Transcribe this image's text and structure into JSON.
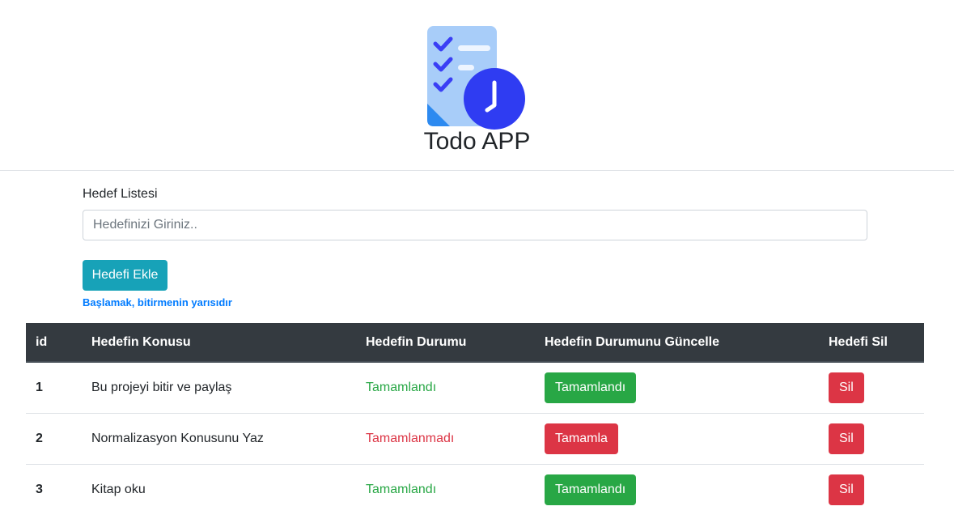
{
  "header": {
    "title": "Todo APP",
    "logo_icon": "checklist-clock-icon"
  },
  "form": {
    "label": "Hedef Listesi",
    "input_placeholder": "Hedefinizi Giriniz..",
    "input_value": "",
    "add_button": "Hedefi Ekle",
    "motto": "Başlamak, bitirmenin yarısıdır"
  },
  "table": {
    "columns": [
      "id",
      "Hedefin Konusu",
      "Hedefin Durumu",
      "Hedefin Durumunu Güncelle",
      "Hedefi Sil"
    ],
    "rows": [
      {
        "id": "1",
        "topic": "Bu projeyi bitir ve paylaş",
        "status": "Tamamlandı",
        "update_button": "Tamamlandı",
        "delete_button": "Sil"
      },
      {
        "id": "2",
        "topic": "Normalizasyon Konusunu Yaz",
        "status": "Tamamlanmadı",
        "update_button": "Tamamla",
        "delete_button": "Sil"
      },
      {
        "id": "3",
        "topic": "Kitap oku",
        "status": "Tamamlandı",
        "update_button": "Tamamlandı",
        "delete_button": "Sil"
      }
    ]
  },
  "colors": {
    "info": "#17a2b8",
    "success": "#28a745",
    "danger": "#dc3545",
    "link": "#007bff",
    "table_header": "#343a40"
  }
}
